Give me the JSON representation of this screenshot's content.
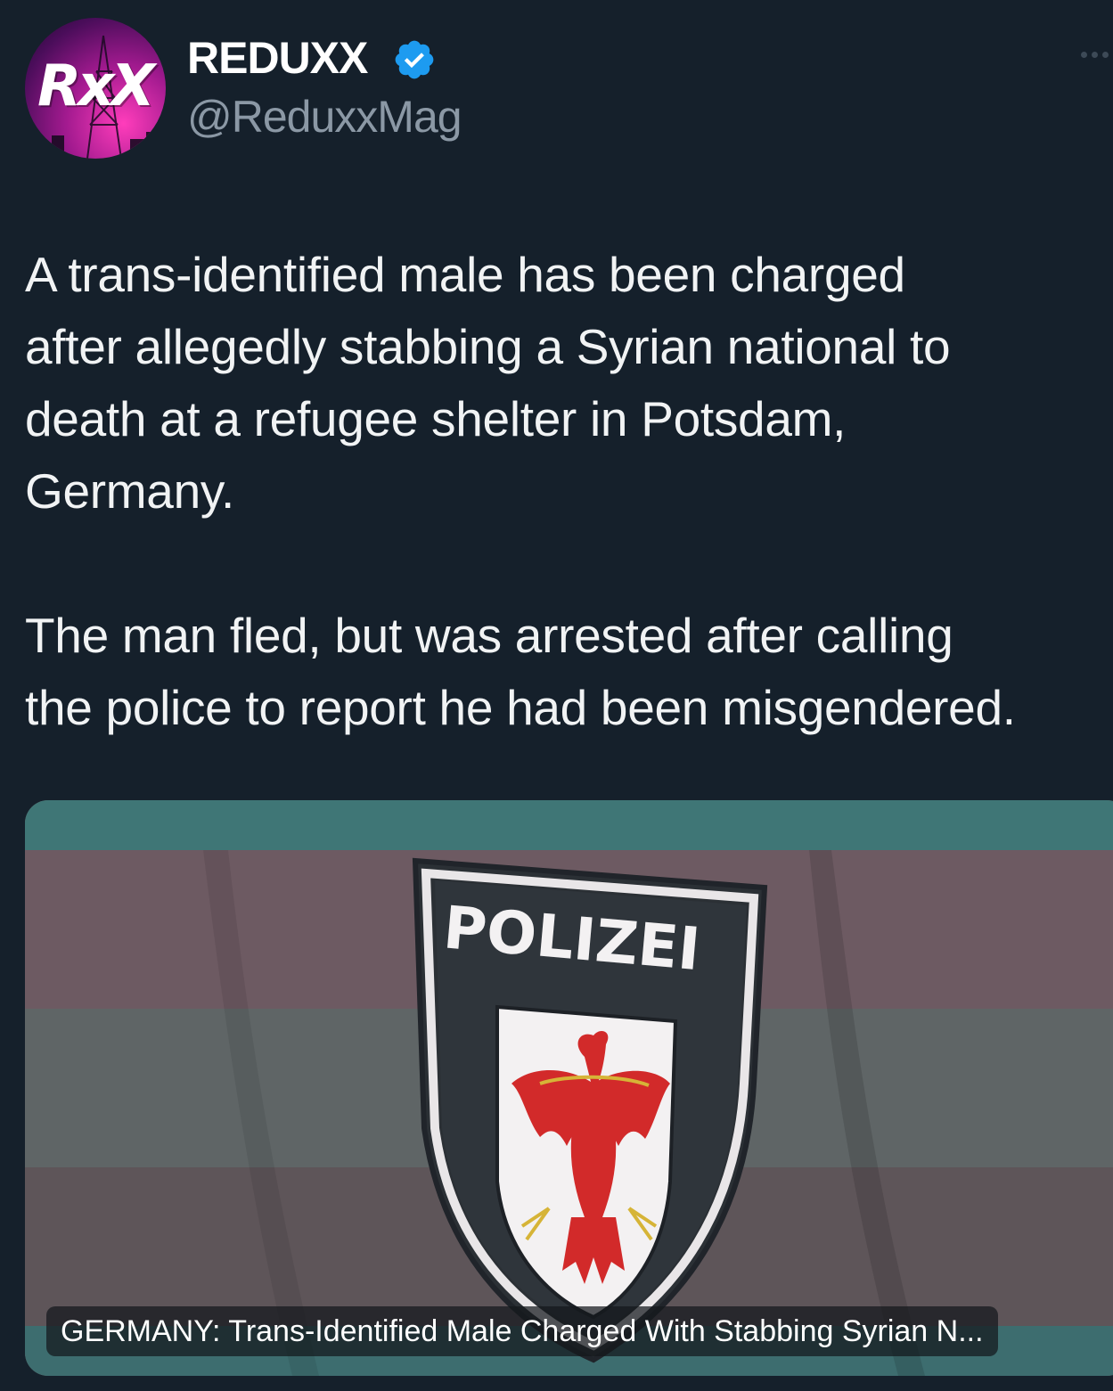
{
  "post": {
    "author": {
      "avatar_text": "RxX",
      "display_name": "REDUXX",
      "handle": "@ReduxxMag",
      "verified_icon": "verified-badge-icon"
    },
    "more_icon": "more-options-icon",
    "paragraphs": [
      [
        "A trans-identified male has been charged",
        "after allegedly stabbing a Syrian national to",
        "death at a refugee shelter in Potsdam,",
        "Germany."
      ],
      [
        "The man fled, but was arrested after calling",
        "the police to report he had been misgendered."
      ]
    ]
  },
  "media": {
    "badge_text": "POLIZEI",
    "caption": "GERMANY: Trans-Identified Male Charged With Stabbing Syrian N...",
    "colors": {
      "accent_blue": "#1d9bf0",
      "flag_teal": "#3f7676",
      "flag_pink": "#6d5a62",
      "eagle_red": "#d22a2a"
    }
  }
}
